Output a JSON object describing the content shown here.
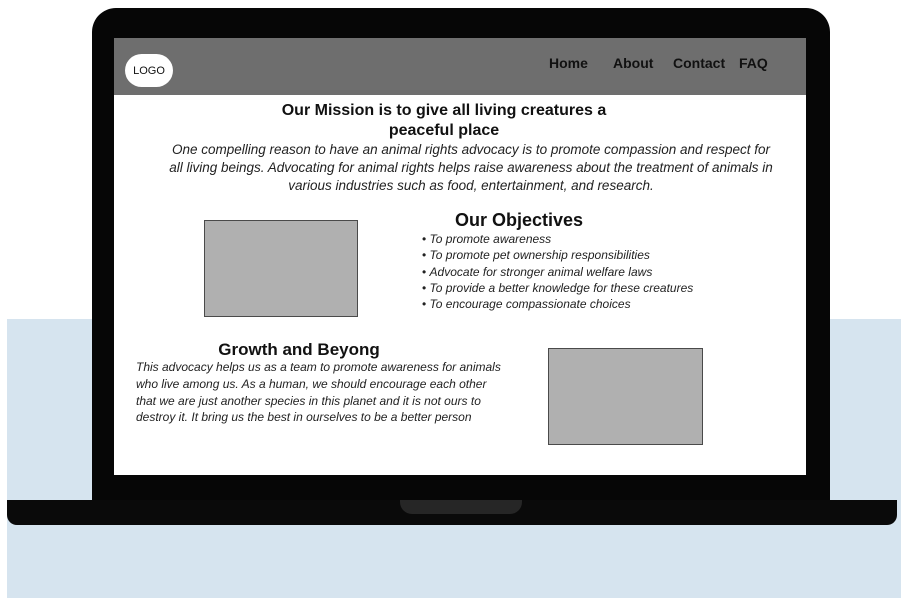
{
  "nav": {
    "logo": "LOGO",
    "links": [
      "Home",
      "About",
      "Contact",
      "FAQ"
    ]
  },
  "mission": {
    "title_line1": "Our Mission is to give all living creatures a",
    "title_line2": "peaceful place",
    "body": "One compelling reason to have an animal rights advocacy is to promote compassion and respect for all living beings. Advocating for animal rights helps raise awareness about the treatment of animals in various industries such as food, entertainment, and research."
  },
  "objectives": {
    "title": "Our Objectives",
    "items": [
      "To promote awareness",
      "To promote pet ownership responsibilities",
      "Advocate for stronger animal welfare laws",
      "To provide a better knowledge for these creatures",
      "To encourage compassionate choices"
    ]
  },
  "growth": {
    "title": "Growth and Beyong",
    "body": "This advocacy helps us as a team to promote awareness for animals who live among us. As a human, we should encourage each other that we are just another species in this planet and it is not ours to destroy it. It bring us the best in ourselves to be a better person"
  },
  "colors": {
    "navbar": "#6e6e6e",
    "backdrop": "#d6e4ef",
    "image_placeholder": "#b0b0b0",
    "accent_edge": "#b8c020"
  }
}
